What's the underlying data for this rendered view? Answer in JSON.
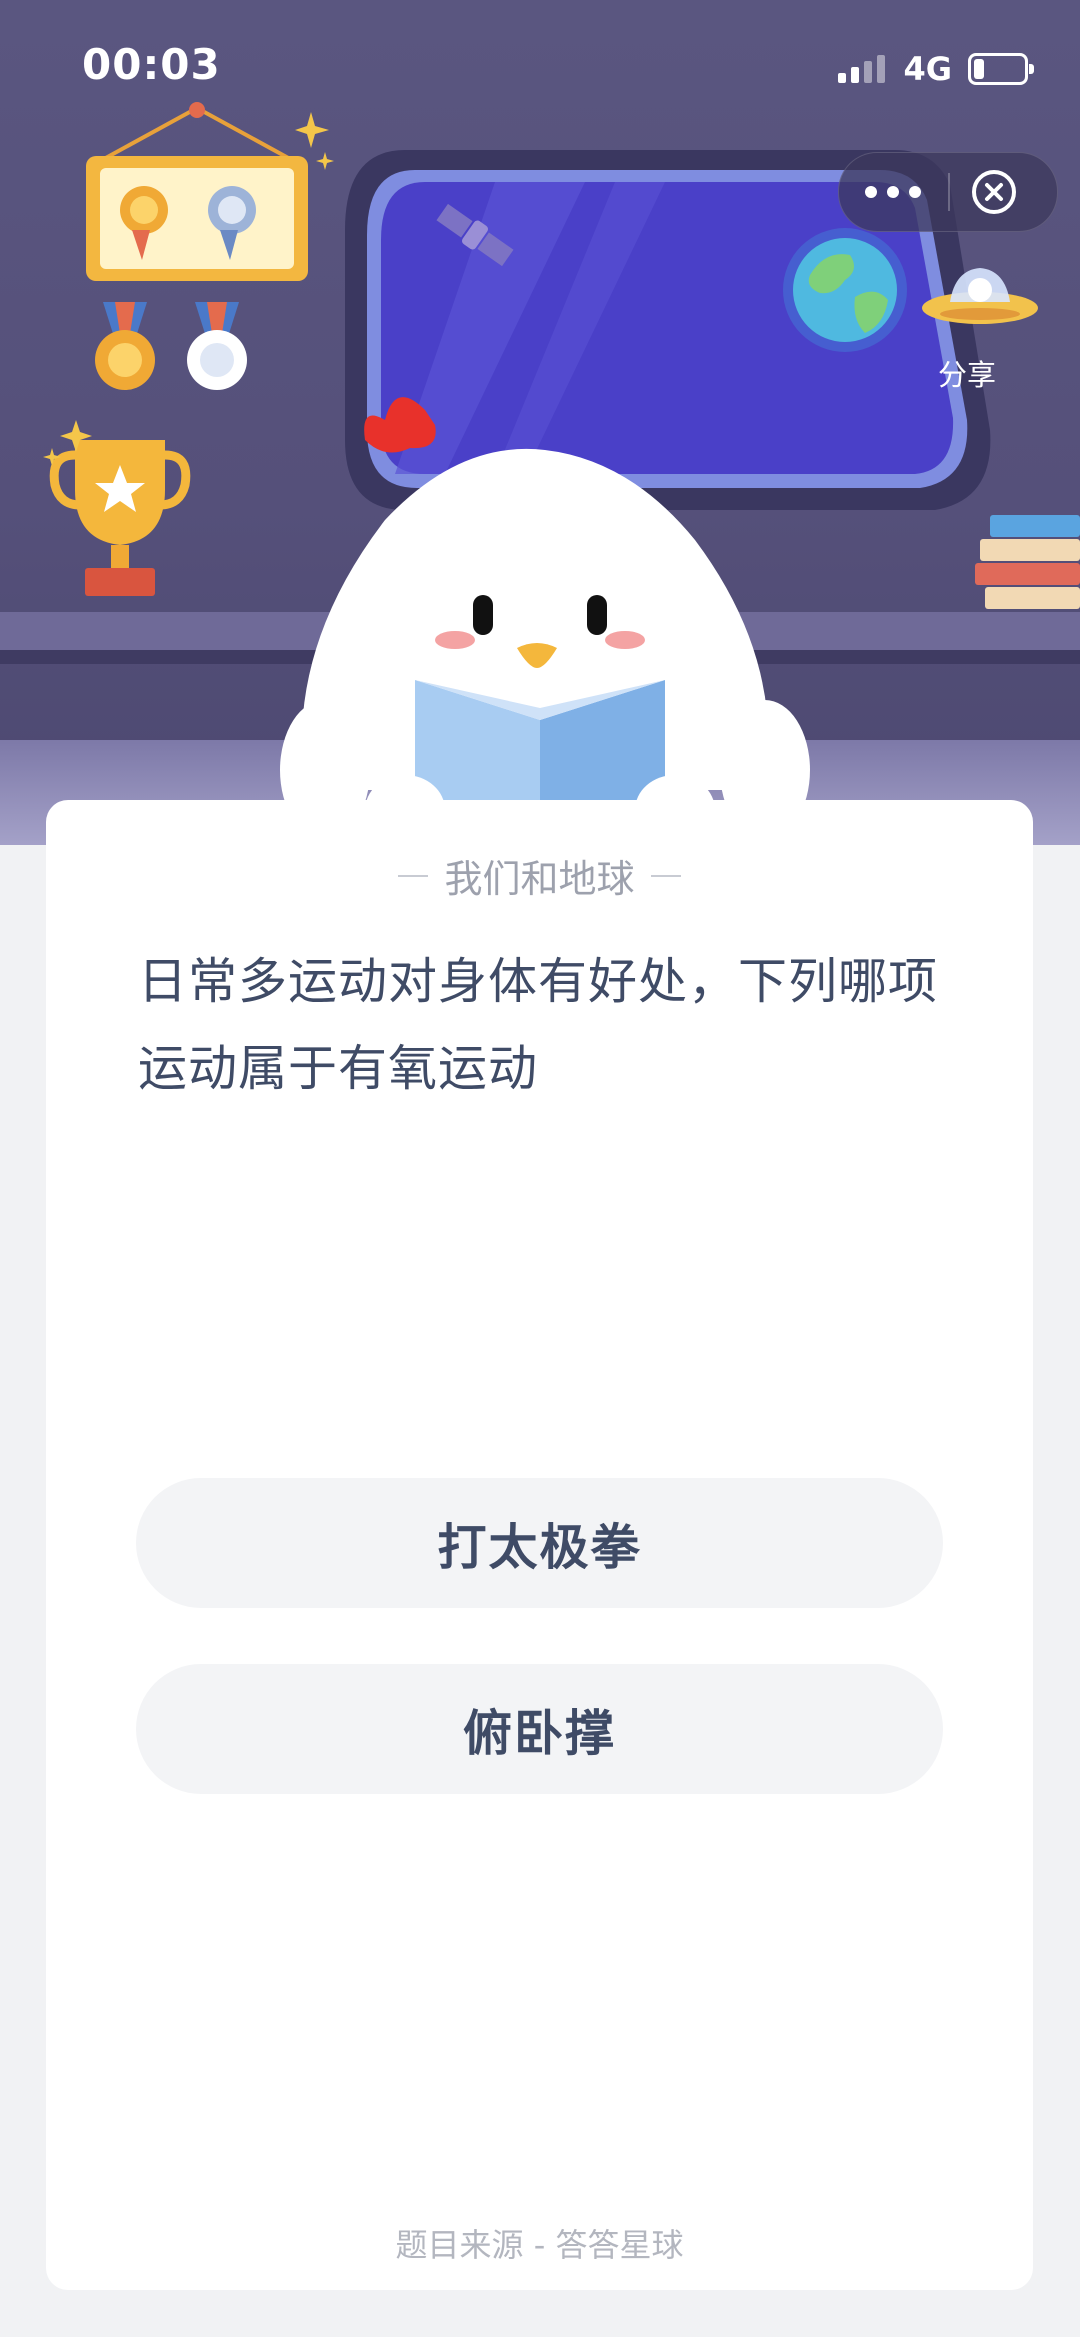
{
  "status_bar": {
    "time": "00:03",
    "network": "4G",
    "battery_level": 0.2
  },
  "toolbar": {
    "more_icon": "more-dots-icon",
    "close_icon": "close-circle-icon",
    "share_label": "分享"
  },
  "card": {
    "category": "我们和地球",
    "question": "日常多运动对身体有好处，下列哪项运动属于有氧运动",
    "options": [
      {
        "label": "打太极拳"
      },
      {
        "label": "俯卧撑"
      }
    ],
    "source": "题目来源 - 答答星球"
  },
  "colors": {
    "scene_bg": "#55507a",
    "window_blue": "#4a40c8",
    "question_text": "#3f4b66",
    "option_bg": "#f3f4f6"
  }
}
